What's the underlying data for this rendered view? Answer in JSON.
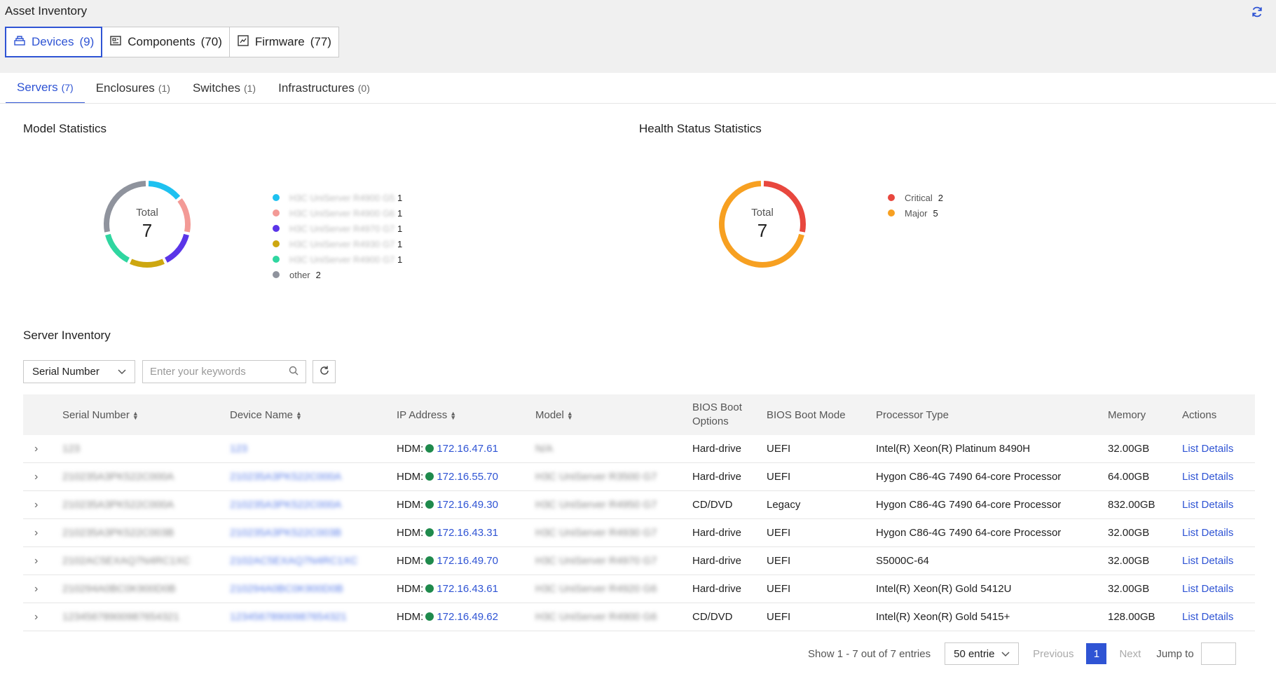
{
  "header": {
    "title": "Asset Inventory"
  },
  "top_tabs": [
    {
      "label": "Devices",
      "count": "(9)"
    },
    {
      "label": "Components",
      "count": "(70)"
    },
    {
      "label": "Firmware",
      "count": "(77)"
    }
  ],
  "sub_tabs": [
    {
      "label": "Servers",
      "count": "(7)"
    },
    {
      "label": "Enclosures",
      "count": "(1)"
    },
    {
      "label": "Switches",
      "count": "(1)"
    },
    {
      "label": "Infrastructures",
      "count": "(0)"
    }
  ],
  "model_stats": {
    "title": "Model Statistics",
    "total_label": "Total",
    "total_value": "7",
    "legend": [
      {
        "name": "H3C UniServer R4900 G5",
        "value": "1",
        "color": "#1ec1f0"
      },
      {
        "name": "H3C UniServer R4900 G6",
        "value": "1",
        "color": "#f39a96"
      },
      {
        "name": "H3C UniServer R4970 G7",
        "value": "1",
        "color": "#5a35e8"
      },
      {
        "name": "H3C UniServer R4930 G7",
        "value": "1",
        "color": "#cda710"
      },
      {
        "name": "H3C UniServer R4900 G7",
        "value": "1",
        "color": "#2fd6a0"
      },
      {
        "name": "other",
        "value": "2",
        "color": "#8f939d"
      }
    ]
  },
  "health_stats": {
    "title": "Health Status Statistics",
    "total_label": "Total",
    "total_value": "7",
    "legend": [
      {
        "name": "Critical",
        "value": "2",
        "color": "#e8473e"
      },
      {
        "name": "Major",
        "value": "5",
        "color": "#f7a021"
      }
    ]
  },
  "inventory": {
    "title": "Server Inventory",
    "filter_select": "Serial Number",
    "search_placeholder": "Enter your keywords",
    "columns": {
      "serial": "Serial Number",
      "device": "Device Name",
      "ip": "IP Address",
      "model": "Model",
      "boot_opt": "BIOS Boot Options",
      "boot_mode": "BIOS Boot Mode",
      "processor": "Processor Type",
      "memory": "Memory",
      "actions": "Actions"
    },
    "rows": [
      {
        "serial": "123",
        "device": "123",
        "ip_prefix": "HDM:",
        "ip": "172.16.47.61",
        "model": "N/A",
        "boot_opt": "Hard-drive",
        "boot_mode": "UEFI",
        "processor": "Intel(R) Xeon(R) Platinum 8490H",
        "memory": "32.00GB",
        "action": "List Details"
      },
      {
        "serial": "210235A3PK522C000A",
        "device": "210235A3PK522C000A",
        "ip_prefix": "HDM:",
        "ip": "172.16.55.70",
        "model": "H3C UniServer R3500 G7",
        "boot_opt": "Hard-drive",
        "boot_mode": "UEFI",
        "processor": "Hygon C86-4G 7490 64-core Processor",
        "memory": "64.00GB",
        "action": "List Details"
      },
      {
        "serial": "210235A3PK522C000A",
        "device": "210235A3PK522C000A",
        "ip_prefix": "HDM:",
        "ip": "172.16.49.30",
        "model": "H3C UniServer R4950 G7",
        "boot_opt": "CD/DVD",
        "boot_mode": "Legacy",
        "processor": "Hygon C86-4G 7490 64-core Processor",
        "memory": "832.00GB",
        "action": "List Details"
      },
      {
        "serial": "210235A3PK522C003B",
        "device": "210235A3PK522C003B",
        "ip_prefix": "HDM:",
        "ip": "172.16.43.31",
        "model": "H3C UniServer R4930 G7",
        "boot_opt": "Hard-drive",
        "boot_mode": "UEFI",
        "processor": "Hygon C86-4G 7490 64-core Processor",
        "memory": "32.00GB",
        "action": "List Details"
      },
      {
        "serial": "2102AC5EXAQ7N4RC1XC",
        "device": "2102AC5EXAQ7N4RC1XC",
        "ip_prefix": "HDM:",
        "ip": "172.16.49.70",
        "model": "H3C UniServer R4970 G7",
        "boot_opt": "Hard-drive",
        "boot_mode": "UEFI",
        "processor": "S5000C-64",
        "memory": "32.00GB",
        "action": "List Details"
      },
      {
        "serial": "210294A0BC0K900D0B",
        "device": "210294A0BC0K900D0B",
        "ip_prefix": "HDM:",
        "ip": "172.16.43.61",
        "model": "H3C UniServer R4920 G6",
        "boot_opt": "Hard-drive",
        "boot_mode": "UEFI",
        "processor": "Intel(R) Xeon(R) Gold 5412U",
        "memory": "32.00GB",
        "action": "List Details"
      },
      {
        "serial": "12345678900987654321",
        "device": "12345678900987654321",
        "ip_prefix": "HDM:",
        "ip": "172.16.49.62",
        "model": "H3C UniServer R4900 G6",
        "boot_opt": "CD/DVD",
        "boot_mode": "UEFI",
        "processor": "Intel(R) Xeon(R) Gold 5415+",
        "memory": "128.00GB",
        "action": "List Details"
      }
    ]
  },
  "pagination": {
    "summary": "Show 1 - 7 out of 7 entries",
    "page_size": "50 entrie",
    "previous": "Previous",
    "current_page": "1",
    "next": "Next",
    "jump_label": "Jump to"
  }
}
